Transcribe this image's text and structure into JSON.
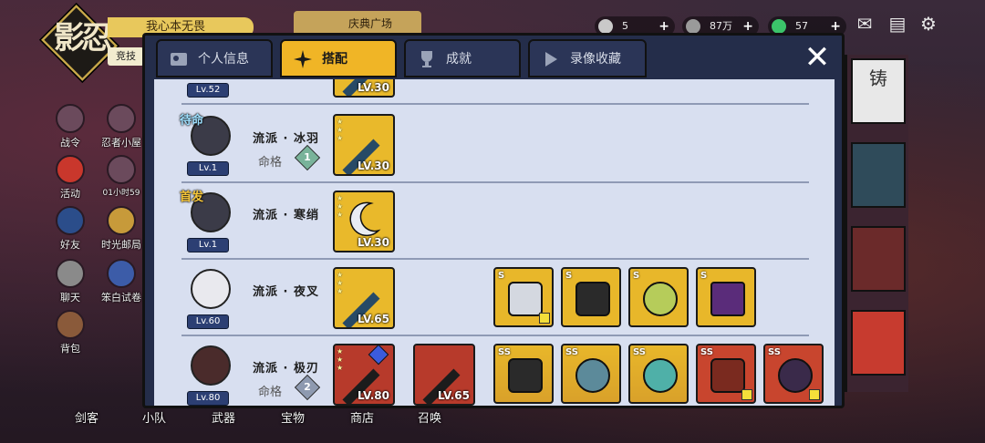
{
  "background": {
    "logo_text": "影忍",
    "player_name": "我心本无畏",
    "rank_tag": "竞技",
    "festival_label": "庆典广场",
    "resources": [
      {
        "icon": "coin-icon",
        "value": "5",
        "color": "#c9c9c9"
      },
      {
        "icon": "gem-icon",
        "value": "87万",
        "color": "#9a9a9a"
      },
      {
        "icon": "jade-icon",
        "value": "57",
        "color": "#3bc46a"
      }
    ],
    "side_menu": [
      {
        "label": "战令",
        "icon": "battle-pass-icon"
      },
      {
        "label": "忍者小屋",
        "icon": "ninja-hut-icon"
      },
      {
        "label": "活动",
        "icon": "torii-icon"
      },
      {
        "label": "01小时59",
        "icon": "timer-icon"
      },
      {
        "label": "好友",
        "icon": "friends-icon"
      },
      {
        "label": "时光邮局",
        "icon": "post-office-icon"
      },
      {
        "label": "聊天",
        "icon": "chat-icon"
      },
      {
        "label": "笨白试卷",
        "icon": "exam-icon"
      },
      {
        "label": "背包",
        "icon": "backpack-icon"
      }
    ],
    "bottom_nav": [
      "剑客",
      "小队",
      "武器",
      "宝物",
      "商店",
      "召唤"
    ],
    "right_banner_text": "铸"
  },
  "modal": {
    "tabs": [
      {
        "label": "个人信息",
        "icon": "profile-card-icon",
        "active": false
      },
      {
        "label": "搭配",
        "icon": "shuriken-icon",
        "active": true
      },
      {
        "label": "成就",
        "icon": "trophy-icon",
        "active": false
      },
      {
        "label": "录像收藏",
        "icon": "play-icon",
        "active": false
      }
    ],
    "close_label": "✕",
    "rows": [
      {
        "badge": "",
        "level": "Lv.52",
        "school": "",
        "fate_label": "",
        "fate_num": "",
        "weapons": [
          {
            "level": "LV.30",
            "color": "gold"
          }
        ],
        "equips": []
      },
      {
        "badge": "待命",
        "badge_style": "blue",
        "level": "Lv.1",
        "school": "流派 · 冰羽",
        "fate_label": "命格",
        "fate_num": "1",
        "weapons": [
          {
            "level": "LV.30",
            "color": "gold"
          }
        ],
        "equips": []
      },
      {
        "badge": "首发",
        "badge_style": "gold",
        "level": "Lv.1",
        "school": "流派 · 寒绡",
        "fate_label": "",
        "fate_num": "",
        "weapons": [
          {
            "level": "LV.30",
            "color": "gold"
          }
        ],
        "equips": []
      },
      {
        "badge": "",
        "level": "Lv.60",
        "school": "流派 · 夜叉",
        "fate_label": "",
        "fate_num": "",
        "weapons": [
          {
            "level": "LV.65",
            "color": "gold"
          }
        ],
        "equips": [
          {
            "tag": "S"
          },
          {
            "tag": "S"
          },
          {
            "tag": "S"
          },
          {
            "tag": "S"
          }
        ]
      },
      {
        "badge": "",
        "level": "Lv.80",
        "school": "流派 · 极刃",
        "fate_label": "命格",
        "fate_num": "2",
        "weapons": [
          {
            "level": "LV.80",
            "color": "red"
          },
          {
            "level": "LV.65",
            "color": "red"
          }
        ],
        "equips": [
          {
            "tag": "SS"
          },
          {
            "tag": "SS"
          },
          {
            "tag": "SS"
          },
          {
            "tag": "SS"
          },
          {
            "tag": "SS"
          }
        ]
      }
    ]
  }
}
